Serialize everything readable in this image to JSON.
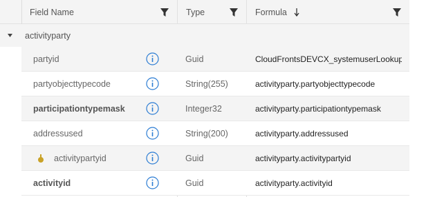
{
  "columns": {
    "field_name": "Field Name",
    "type": "Type",
    "formula": "Formula"
  },
  "group": {
    "label": "activityparty"
  },
  "rows": [
    {
      "field": "partyid",
      "type": "Guid",
      "formula": "CloudFrontsDEVCX_systemuserLookup.systemuserid",
      "bold": false,
      "key": false
    },
    {
      "field": "partyobjecttypecode",
      "type": "String(255)",
      "formula": "activityparty.partyobjecttypecode",
      "bold": false,
      "key": false
    },
    {
      "field": "participationtypemask",
      "type": "Integer32",
      "formula": "activityparty.participationtypemask",
      "bold": true,
      "key": false
    },
    {
      "field": "addressused",
      "type": "String(200)",
      "formula": "activityparty.addressused",
      "bold": false,
      "key": false
    },
    {
      "field": "activitypartyid",
      "type": "Guid",
      "formula": "activityparty.activitypartyid",
      "bold": false,
      "key": true
    },
    {
      "field": "activityid",
      "type": "Guid",
      "formula": "activityparty.activityid",
      "bold": true,
      "key": false
    }
  ],
  "colors": {
    "info_icon": "#2b7cd3",
    "key_icon": "#c9a227"
  }
}
